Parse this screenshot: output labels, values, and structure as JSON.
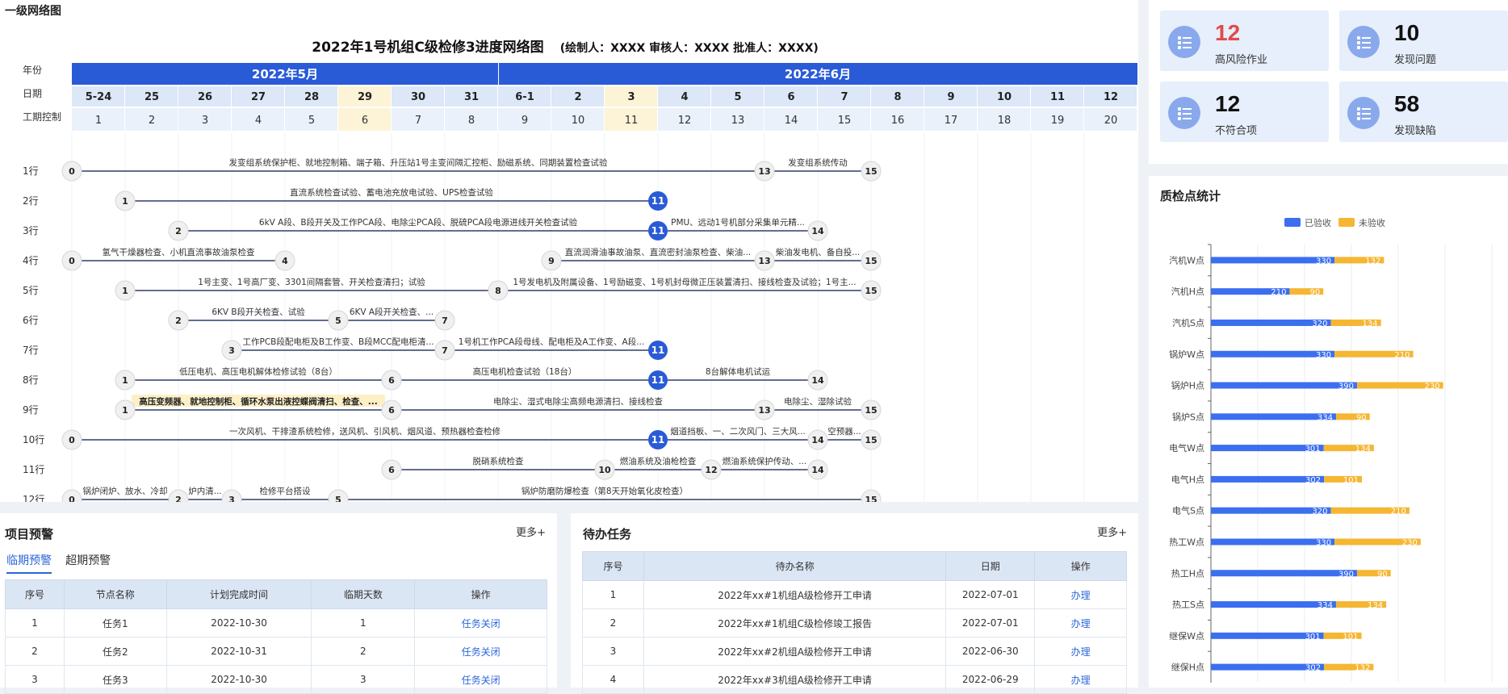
{
  "network": {
    "panel_title": "一级网络图",
    "title": "2022年1号机组C级检修3进度网络图",
    "sign_line": "(绘制人：XXXX 审核人：XXXX 批准人：XXXX)",
    "row_labels": {
      "year": "年份",
      "date": "日期",
      "period": "工期控制"
    },
    "months": [
      "2022年5月",
      "2022年6月"
    ],
    "dates": [
      "5-24",
      "25",
      "26",
      "27",
      "28",
      "29",
      "30",
      "31",
      "6-1",
      "2",
      "3",
      "4",
      "5",
      "6",
      "7",
      "8",
      "9",
      "10",
      "11",
      "12"
    ],
    "periods": [
      "1",
      "2",
      "3",
      "4",
      "5",
      "6",
      "7",
      "8",
      "9",
      "10",
      "11",
      "12",
      "13",
      "14",
      "15",
      "16",
      "17",
      "18",
      "19",
      "20"
    ],
    "highlight_dates": [
      5,
      10
    ],
    "lane_labels": [
      "1行",
      "2行",
      "3行",
      "4行",
      "5行",
      "6行",
      "7行",
      "8行",
      "9行",
      "10行",
      "11行",
      "12行"
    ],
    "lanes": [
      {
        "nodes": [
          {
            "n": "0",
            "d": 0
          },
          {
            "n": "13",
            "d": 13
          },
          {
            "n": "15",
            "d": 15
          }
        ],
        "edges": [
          {
            "a": 0,
            "b": 13,
            "t": "发变组系统保护柜、就地控制箱、端子箱、升压站1号主变间隔汇控柜、励磁系统、同期装置检查试验"
          },
          {
            "a": 13,
            "b": 15,
            "t": "发变组系统传动"
          }
        ]
      },
      {
        "nodes": [
          {
            "n": "1",
            "d": 1
          },
          {
            "n": "11",
            "d": 11,
            "key": true
          }
        ],
        "edges": [
          {
            "a": 1,
            "b": 11,
            "t": "直流系统检查试验、蓄电池充放电试验、UPS检查试验"
          }
        ]
      },
      {
        "nodes": [
          {
            "n": "2",
            "d": 2
          },
          {
            "n": "11",
            "d": 11,
            "key": true
          },
          {
            "n": "14",
            "d": 14
          }
        ],
        "edges": [
          {
            "a": 2,
            "b": 11,
            "t": "6kV A段、B段开关及工作PCA段、电除尘PCA段、脱硫PCA段电源进线开关检查试验"
          },
          {
            "a": 11,
            "b": 14,
            "t": "PMU、远动1号机部分采集单元精..."
          }
        ]
      },
      {
        "nodes": [
          {
            "n": "0",
            "d": 0
          },
          {
            "n": "4",
            "d": 4
          },
          {
            "n": "9",
            "d": 9
          },
          {
            "n": "13",
            "d": 13
          },
          {
            "n": "15",
            "d": 15
          }
        ],
        "edges": [
          {
            "a": 0,
            "b": 4,
            "t": "氢气干燥器检查、小机直流事故油泵检查"
          },
          {
            "a": 9,
            "b": 13,
            "t": "直流润滑油事故油泵、直流密封油泵检查、柴油..."
          },
          {
            "a": 13,
            "b": 15,
            "t": "柴油发电机、备自投..."
          }
        ]
      },
      {
        "nodes": [
          {
            "n": "1",
            "d": 1
          },
          {
            "n": "8",
            "d": 8
          },
          {
            "n": "15",
            "d": 15
          }
        ],
        "edges": [
          {
            "a": 1,
            "b": 8,
            "t": "1号主变、1号高厂变、3301间隔套管、开关检查清扫；试验"
          },
          {
            "a": 8,
            "b": 15,
            "t": "1号发电机及附属设备、1号励磁变、1号机封母微正压装置清扫、接线检查及试验；1号主..."
          }
        ]
      },
      {
        "nodes": [
          {
            "n": "2",
            "d": 2
          },
          {
            "n": "5",
            "d": 5
          },
          {
            "n": "7",
            "d": 7
          }
        ],
        "edges": [
          {
            "a": 2,
            "b": 5,
            "t": "6KV B段开关检查、试验"
          },
          {
            "a": 5,
            "b": 7,
            "t": "6KV A段开关检查、..."
          }
        ]
      },
      {
        "nodes": [
          {
            "n": "3",
            "d": 3
          },
          {
            "n": "7",
            "d": 7
          },
          {
            "n": "11",
            "d": 11,
            "key": true
          }
        ],
        "edges": [
          {
            "a": 3,
            "b": 7,
            "t": "工作PCB段配电柜及B工作变、B段MCC配电柜清..."
          },
          {
            "a": 7,
            "b": 11,
            "t": "1号机工作PCA段母线、配电柜及A工作变、A段..."
          }
        ]
      },
      {
        "nodes": [
          {
            "n": "1",
            "d": 1
          },
          {
            "n": "6",
            "d": 6
          },
          {
            "n": "11",
            "d": 11,
            "key": true
          },
          {
            "n": "14",
            "d": 14
          }
        ],
        "edges": [
          {
            "a": 1,
            "b": 6,
            "t": "低压电机、高压电机解体检修试验（8台）"
          },
          {
            "a": 6,
            "b": 11,
            "t": "高压电机检查试验（18台）"
          },
          {
            "a": 11,
            "b": 14,
            "t": "8台解体电机试运"
          }
        ]
      },
      {
        "nodes": [
          {
            "n": "1",
            "d": 1
          },
          {
            "n": "6",
            "d": 6
          },
          {
            "n": "13",
            "d": 13
          },
          {
            "n": "15",
            "d": 15
          }
        ],
        "edges": [
          {
            "a": 1,
            "b": 6,
            "t": "高压变频器、就地控制柜、循环水泵出液控蝶阀清扫、检查、...",
            "hl": true
          },
          {
            "a": 6,
            "b": 13,
            "t": "电除尘、湿式电除尘高频电源清扫、接线检查"
          },
          {
            "a": 13,
            "b": 15,
            "t": "电除尘、湿除试验"
          }
        ]
      },
      {
        "nodes": [
          {
            "n": "0",
            "d": 0
          },
          {
            "n": "11",
            "d": 11,
            "key": true
          },
          {
            "n": "14",
            "d": 14
          },
          {
            "n": "15",
            "d": 15
          }
        ],
        "edges": [
          {
            "a": 0,
            "b": 11,
            "t": "一次风机、干排渣系统检修，送风机、引风机、烟风道、预热器检查检修"
          },
          {
            "a": 11,
            "b": 14,
            "t": "烟道挡板、一、二次风门、三大风..."
          },
          {
            "a": 14,
            "b": 15,
            "t": "空预器..."
          }
        ]
      },
      {
        "nodes": [
          {
            "n": "6",
            "d": 6
          },
          {
            "n": "10",
            "d": 10
          },
          {
            "n": "12",
            "d": 12
          },
          {
            "n": "14",
            "d": 14
          }
        ],
        "edges": [
          {
            "a": 6,
            "b": 10,
            "t": "脱硝系统检查"
          },
          {
            "a": 10,
            "b": 12,
            "t": "燃油系统及油枪检查"
          },
          {
            "a": 12,
            "b": 14,
            "t": "燃油系统保护传动、..."
          }
        ]
      },
      {
        "nodes": [
          {
            "n": "0",
            "d": 0
          },
          {
            "n": "2",
            "d": 2
          },
          {
            "n": "3",
            "d": 3
          },
          {
            "n": "5",
            "d": 5
          },
          {
            "n": "15",
            "d": 15
          }
        ],
        "edges": [
          {
            "a": 0,
            "b": 2,
            "t": "锅炉闭炉、放水、冷却"
          },
          {
            "a": 2,
            "b": 3,
            "t": "炉内清..."
          },
          {
            "a": 3,
            "b": 5,
            "t": "检修平台搭设"
          },
          {
            "a": 5,
            "b": 15,
            "t": "锅炉防磨防爆检查（第8天开始氧化皮检查）"
          }
        ]
      }
    ]
  },
  "kpis": [
    {
      "value": "12",
      "label": "高风险作业",
      "highlight": true
    },
    {
      "value": "10",
      "label": "发现问题"
    },
    {
      "value": "12",
      "label": "不符合项"
    },
    {
      "value": "58",
      "label": "发现缺陷"
    }
  ],
  "kpi_icon": "list-icon",
  "quality": {
    "title": "质检点统计",
    "legend": [
      "已验收",
      "未验收"
    ],
    "colors": {
      "accepted": "#3b6ff0",
      "pending": "#f5b632"
    }
  },
  "chart_data": {
    "type": "bar",
    "orientation": "horizontal",
    "stacked": true,
    "title": "质检点统计",
    "categories": [
      "汽机W点",
      "汽机H点",
      "汽机S点",
      "锅炉W点",
      "锅炉H点",
      "锅炉S点",
      "电气W点",
      "电气H点",
      "电气S点",
      "热工W点",
      "热工H点",
      "热工S点",
      "继保W点",
      "继保H点"
    ],
    "series": [
      {
        "name": "已验收",
        "values": [
          330,
          210,
          320,
          330,
          390,
          334,
          301,
          302,
          320,
          330,
          390,
          334,
          301,
          302
        ]
      },
      {
        "name": "未验收",
        "values": [
          132,
          90,
          134,
          210,
          230,
          90,
          134,
          101,
          210,
          230,
          90,
          134,
          101,
          132
        ]
      }
    ],
    "xlim": [
      0,
      750
    ],
    "legend_position": "top-center",
    "grid": true
  },
  "warning": {
    "title": "项目预警",
    "more": "更多+",
    "tabs": [
      "临期预警",
      "超期预警"
    ],
    "columns": [
      "序号",
      "节点名称",
      "计划完成时间",
      "临期天数",
      "操作"
    ],
    "rows": [
      [
        "1",
        "任务1",
        "2022-10-30",
        "1",
        "任务关闭"
      ],
      [
        "2",
        "任务2",
        "2022-10-31",
        "2",
        "任务关闭"
      ],
      [
        "3",
        "任务3",
        "2022-10-30",
        "3",
        "任务关闭"
      ]
    ]
  },
  "todo": {
    "title": "待办任务",
    "more": "更多+",
    "columns": [
      "序号",
      "待办名称",
      "日期",
      "操作"
    ],
    "rows": [
      [
        "1",
        "2022年xx#1机组A级检修开工申请",
        "2022-07-01",
        "办理"
      ],
      [
        "2",
        "2022年xx#1机组C级检修竣工报告",
        "2022-07-01",
        "办理"
      ],
      [
        "3",
        "2022年xx#2机组A级检修开工申请",
        "2022-06-30",
        "办理"
      ],
      [
        "4",
        "2022年xx#3机组A级检修开工申请",
        "2022-06-29",
        "办理"
      ]
    ]
  }
}
